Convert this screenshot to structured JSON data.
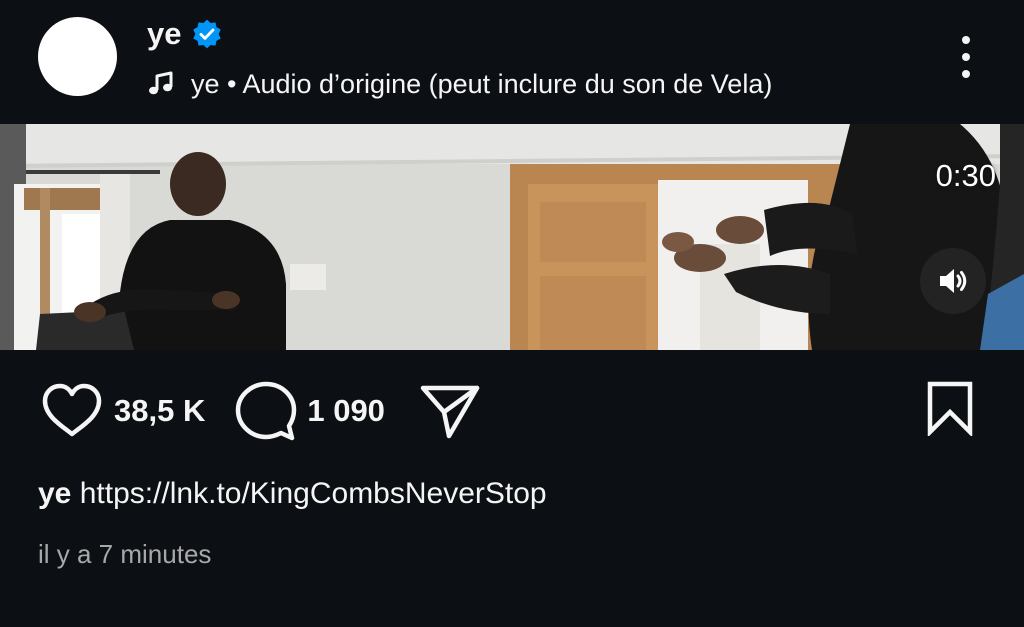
{
  "post": {
    "username": "ye",
    "verified": true,
    "audio_text": "ye • Audio d’origine (peut inclure du son de Vela)"
  },
  "video": {
    "timer": "0:30"
  },
  "actions": {
    "likes": "38,5 K",
    "comments": "1 090"
  },
  "caption": {
    "username": "ye",
    "link": "https://lnk.to/KingCombsNeverStop"
  },
  "time_ago": "il y a 7 minutes",
  "icons": {
    "avatar": "avatar-circle",
    "verified": "verified-badge-icon",
    "music": "music-note-icon",
    "more": "more-vertical-icon",
    "mute": "speaker-icon",
    "like": "heart-icon",
    "comment": "comment-bubble-icon",
    "share": "send-icon",
    "save": "bookmark-icon"
  },
  "colors": {
    "background": "#0c1014",
    "text": "#f5f5f5",
    "secondary_text": "#a8a8a8",
    "verified_blue": "#0095f6"
  }
}
